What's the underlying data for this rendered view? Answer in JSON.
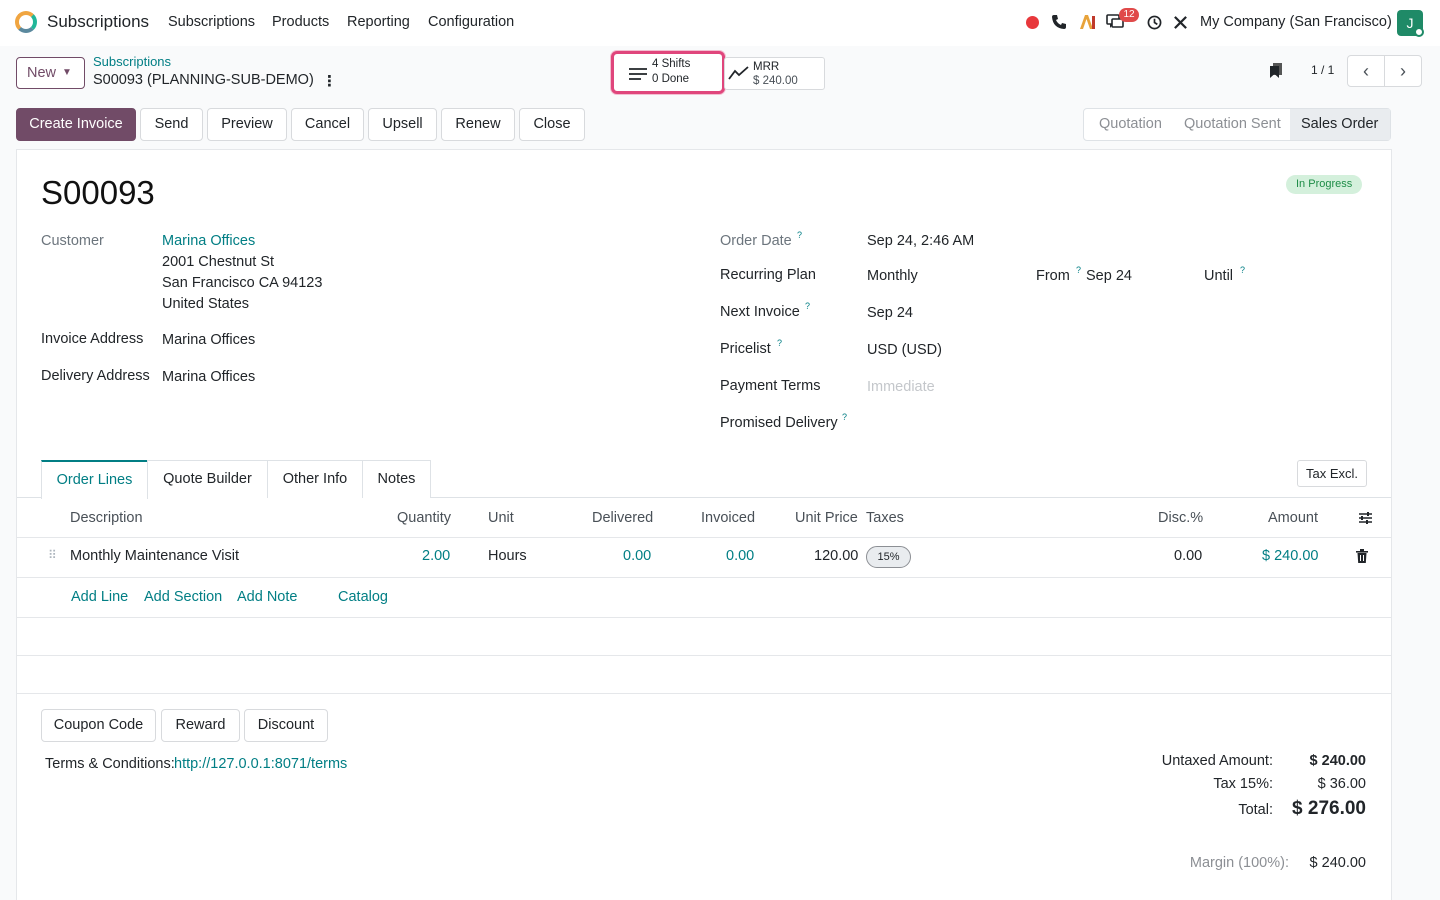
{
  "navbar": {
    "app_name": "Subscriptions",
    "menu": [
      "Subscriptions",
      "Products",
      "Reporting",
      "Configuration"
    ],
    "message_count": "12",
    "company": "My Company (San Francisco)",
    "avatar_initial": "J"
  },
  "control": {
    "new_label": "New",
    "breadcrumb_parent": "Subscriptions",
    "breadcrumb_current": "S00093 (PLANNING-SUB-DEMO)",
    "shifts_line1": "4 Shifts",
    "shifts_line2": "0 Done",
    "mrr_line1": "MRR",
    "mrr_line2": "$ 240.00",
    "pager": "1 / 1"
  },
  "actions": [
    "Create Invoice",
    "Send",
    "Preview",
    "Cancel",
    "Upsell",
    "Renew",
    "Close"
  ],
  "statusbar": [
    "Quotation",
    "Quotation Sent",
    "Sales Order"
  ],
  "record": {
    "title": "S00093",
    "state": "In Progress",
    "customer_label": "Customer",
    "customer_name": "Marina Offices",
    "address": [
      "2001 Chestnut St",
      "San Francisco CA 94123",
      "United States"
    ],
    "invoice_address_label": "Invoice Address",
    "invoice_address": "Marina Offices",
    "delivery_address_label": "Delivery Address",
    "delivery_address": "Marina Offices",
    "order_date_label": "Order Date",
    "order_date": "Sep 24, 2:46 AM",
    "plan_label": "Recurring Plan",
    "plan": "Monthly",
    "from_label": "From",
    "from": "Sep 24",
    "until_label": "Until",
    "next_invoice_label": "Next Invoice",
    "next_invoice": "Sep 24",
    "pricelist_label": "Pricelist",
    "pricelist": "USD (USD)",
    "payment_terms_label": "Payment Terms",
    "payment_terms_placeholder": "Immediate",
    "promised_label": "Promised Delivery",
    "help": "?"
  },
  "tabs": [
    "Order Lines",
    "Quote Builder",
    "Other Info",
    "Notes"
  ],
  "tax_toggle": "Tax Excl.",
  "table": {
    "headers": [
      "Description",
      "Quantity",
      "Unit",
      "Delivered",
      "Invoiced",
      "Unit Price",
      "Taxes",
      "Disc.%",
      "Amount"
    ],
    "rows": [
      {
        "description": "Monthly Maintenance Visit",
        "quantity": "2.00",
        "unit": "Hours",
        "delivered": "0.00",
        "invoiced": "0.00",
        "unit_price": "120.00",
        "taxes": "15%",
        "disc": "0.00",
        "amount": "$ 240.00"
      }
    ],
    "add_links": [
      "Add Line",
      "Add Section",
      "Add Note",
      "Catalog"
    ]
  },
  "footer": {
    "buttons": [
      "Coupon Code",
      "Reward",
      "Discount"
    ],
    "terms_label": "Terms & Conditions:",
    "terms_url": "http://127.0.0.1:8071/terms",
    "untaxed_label": "Untaxed Amount:",
    "untaxed": "$ 240.00",
    "tax_label": "Tax 15%:",
    "tax": "$ 36.00",
    "total_label": "Total:",
    "total": "$ 276.00",
    "margin_label": "Margin (100%):",
    "margin": "$ 240.00"
  },
  "colors": {
    "primary": "#714b67",
    "link": "#017e84",
    "highlight": "#e0467c"
  }
}
